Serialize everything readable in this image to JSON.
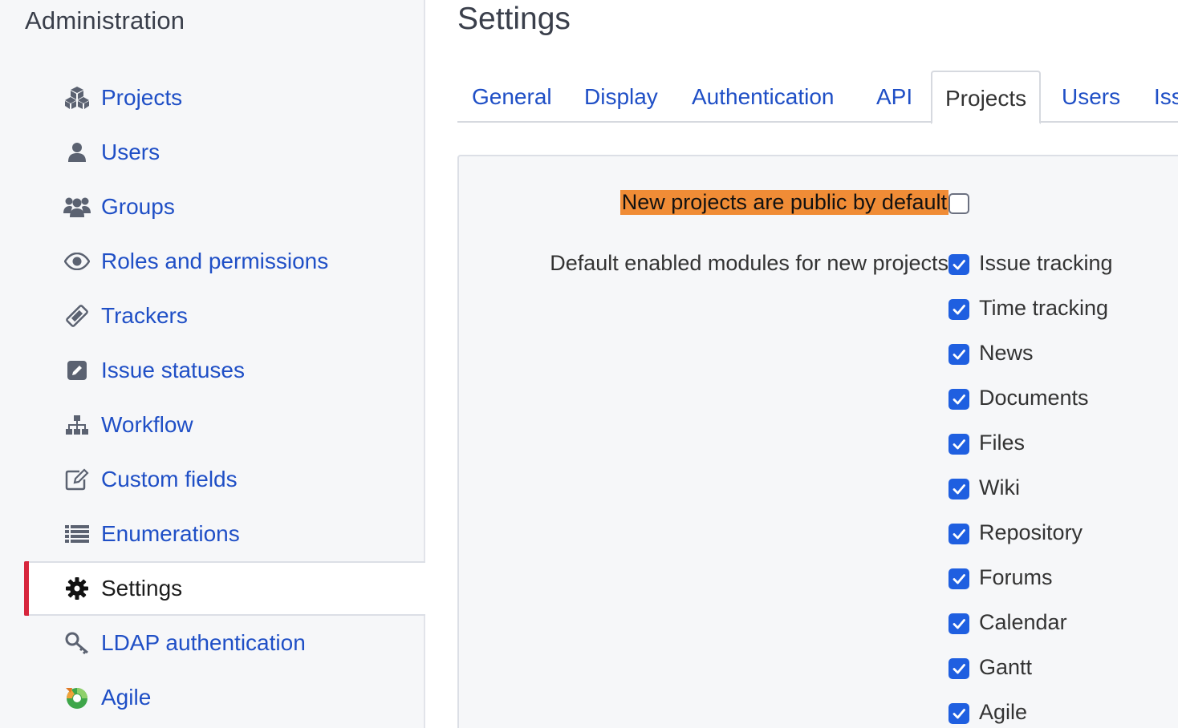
{
  "sidebar": {
    "title": "Administration",
    "items": [
      {
        "label": "Projects",
        "icon": "cubes-icon"
      },
      {
        "label": "Users",
        "icon": "user-icon"
      },
      {
        "label": "Groups",
        "icon": "users-group-icon"
      },
      {
        "label": "Roles and permissions",
        "icon": "eye-icon"
      },
      {
        "label": "Trackers",
        "icon": "ticket-icon"
      },
      {
        "label": "Issue statuses",
        "icon": "pencil-square-icon"
      },
      {
        "label": "Workflow",
        "icon": "sitemap-icon"
      },
      {
        "label": "Custom fields",
        "icon": "edit-icon"
      },
      {
        "label": "Enumerations",
        "icon": "list-icon"
      },
      {
        "label": "Settings",
        "icon": "gear-icon",
        "selected": true
      },
      {
        "label": "LDAP authentication",
        "icon": "key-icon"
      },
      {
        "label": "Agile",
        "icon": "agile-icon"
      }
    ]
  },
  "main": {
    "title": "Settings",
    "tabs": [
      {
        "label": "General"
      },
      {
        "label": "Display"
      },
      {
        "label": "Authentication"
      },
      {
        "label": "API"
      },
      {
        "label": "Projects",
        "active": true
      },
      {
        "label": "Users"
      },
      {
        "label": "Iss"
      }
    ],
    "public_default": {
      "label": "New projects are public by default",
      "checked": false
    },
    "modules": {
      "label": "Default enabled modules for new projects",
      "items": [
        {
          "label": "Issue tracking",
          "checked": true
        },
        {
          "label": "Time tracking",
          "checked": true
        },
        {
          "label": "News",
          "checked": true
        },
        {
          "label": "Documents",
          "checked": true
        },
        {
          "label": "Files",
          "checked": true
        },
        {
          "label": "Wiki",
          "checked": true
        },
        {
          "label": "Repository",
          "checked": true
        },
        {
          "label": "Forums",
          "checked": true
        },
        {
          "label": "Calendar",
          "checked": true
        },
        {
          "label": "Gantt",
          "checked": true
        },
        {
          "label": "Agile",
          "checked": true
        }
      ]
    }
  },
  "colors": {
    "link": "#1f4fc6",
    "highlight": "#f08c36",
    "checkbox": "#1f5fe0",
    "selected_bar": "#d7263d"
  }
}
